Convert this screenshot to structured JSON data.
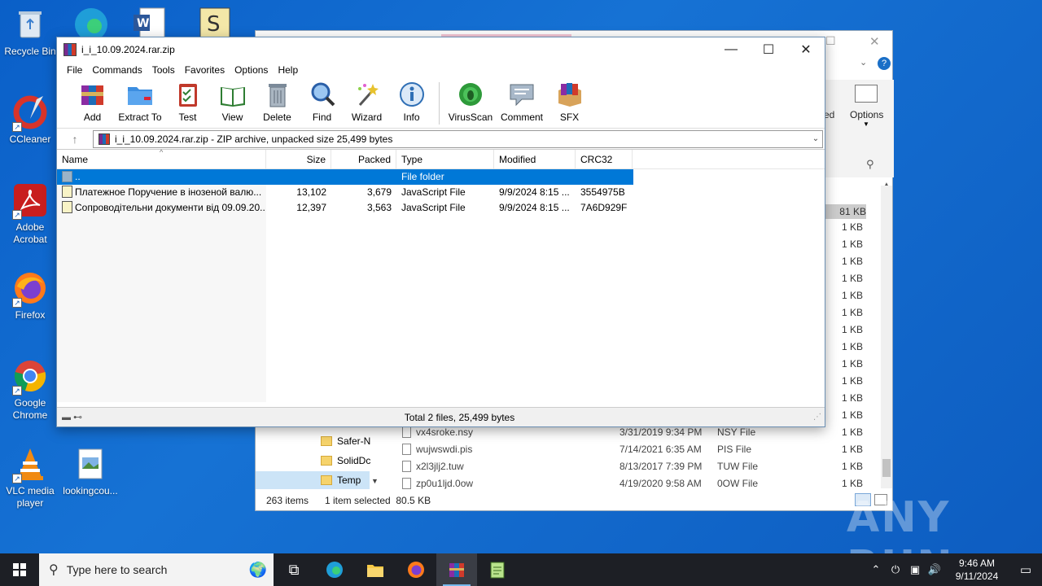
{
  "desktop": {
    "icons": [
      {
        "label": "Recycle Bin",
        "icon": "recycle-bin-icon"
      },
      {
        "label": "CCleaner",
        "icon": "ccleaner-icon"
      },
      {
        "label": "Adobe Acrobat",
        "icon": "acrobat-icon"
      },
      {
        "label": "Firefox",
        "icon": "firefox-icon"
      },
      {
        "label": "Google Chrome",
        "icon": "chrome-icon"
      },
      {
        "label": "VLC media player",
        "icon": "vlc-icon"
      },
      {
        "label": "lookingcou...",
        "icon": "image-file-icon"
      }
    ]
  },
  "explorer": {
    "nav_items": [
      "Safer-N",
      "SolidDc",
      "Temp"
    ],
    "files": [
      {
        "name": "vx4sroke.nsy",
        "date": "3/31/2019 9:34 PM",
        "type": "NSY File",
        "size": "1 KB"
      },
      {
        "name": "wujwswdi.pis",
        "date": "7/14/2021 6:35 AM",
        "type": "PIS File",
        "size": "1 KB"
      },
      {
        "name": "x2l3jlj2.tuw",
        "date": "8/13/2017 7:39 PM",
        "type": "TUW File",
        "size": "1 KB"
      },
      {
        "name": "zp0u1ljd.0ow",
        "date": "4/19/2020 9:58 AM",
        "type": "0OW File",
        "size": "1 KB"
      }
    ],
    "size_column": [
      "81 KB",
      "1 KB",
      "1 KB",
      "1 KB",
      "1 KB",
      "1 KB",
      "1 KB",
      "1 KB",
      "1 KB",
      "1 KB",
      "1 KB",
      "1 KB",
      "1 KB",
      "1 KB",
      "1 KB",
      "1 KB",
      "1 KB",
      "1 KB"
    ],
    "ribbon_partial": "ed",
    "options_label": "Options",
    "status_items": "263 items",
    "status_selected": "1 item selected  80.5 KB"
  },
  "winrar": {
    "title": "i_i_10.09.2024.rar.zip",
    "menu": [
      "File",
      "Commands",
      "Tools",
      "Favorites",
      "Options",
      "Help"
    ],
    "toolbar": [
      {
        "label": "Add",
        "color": "#c0392b"
      },
      {
        "label": "Extract To",
        "color": "#3c8ee0"
      },
      {
        "label": "Test",
        "color": "#d9534f"
      },
      {
        "label": "View",
        "color": "#2e7d32"
      },
      {
        "label": "Delete",
        "color": "#7b8a99"
      },
      {
        "label": "Find",
        "color": "#3f7fd0"
      },
      {
        "label": "Wizard",
        "color": "#8e6bbf"
      },
      {
        "label": "Info",
        "color": "#2f6fb5"
      },
      {
        "label": "VirusScan",
        "color": "#2e9a3a"
      },
      {
        "label": "Comment",
        "color": "#8a9bb0"
      },
      {
        "label": "SFX",
        "color": "#d08a2e"
      }
    ],
    "address": "i_i_10.09.2024.rar.zip - ZIP archive, unpacked size 25,499 bytes",
    "columns": {
      "name": "Name",
      "size": "Size",
      "packed": "Packed",
      "type": "Type",
      "modified": "Modified",
      "crc": "CRC32"
    },
    "rows": [
      {
        "name": "..",
        "size": "",
        "packed": "",
        "type": "File folder",
        "modified": "",
        "crc": "",
        "selected": true
      },
      {
        "name": "Платежное Поручение в інозеной валю...",
        "size": "13,102",
        "packed": "3,679",
        "type": "JavaScript File",
        "modified": "9/9/2024 8:15 ...",
        "crc": "3554975B"
      },
      {
        "name": "Сопроводітельни документи від 09.09.20...",
        "size": "12,397",
        "packed": "3,563",
        "type": "JavaScript File",
        "modified": "9/9/2024 8:15 ...",
        "crc": "7A6D929F"
      }
    ],
    "status_total": "Total 2 files, 25,499 bytes"
  },
  "taskbar": {
    "search_placeholder": "Type here to search",
    "time": "9:46 AM",
    "date": "9/11/2024"
  },
  "watermark": "ANY RUN"
}
